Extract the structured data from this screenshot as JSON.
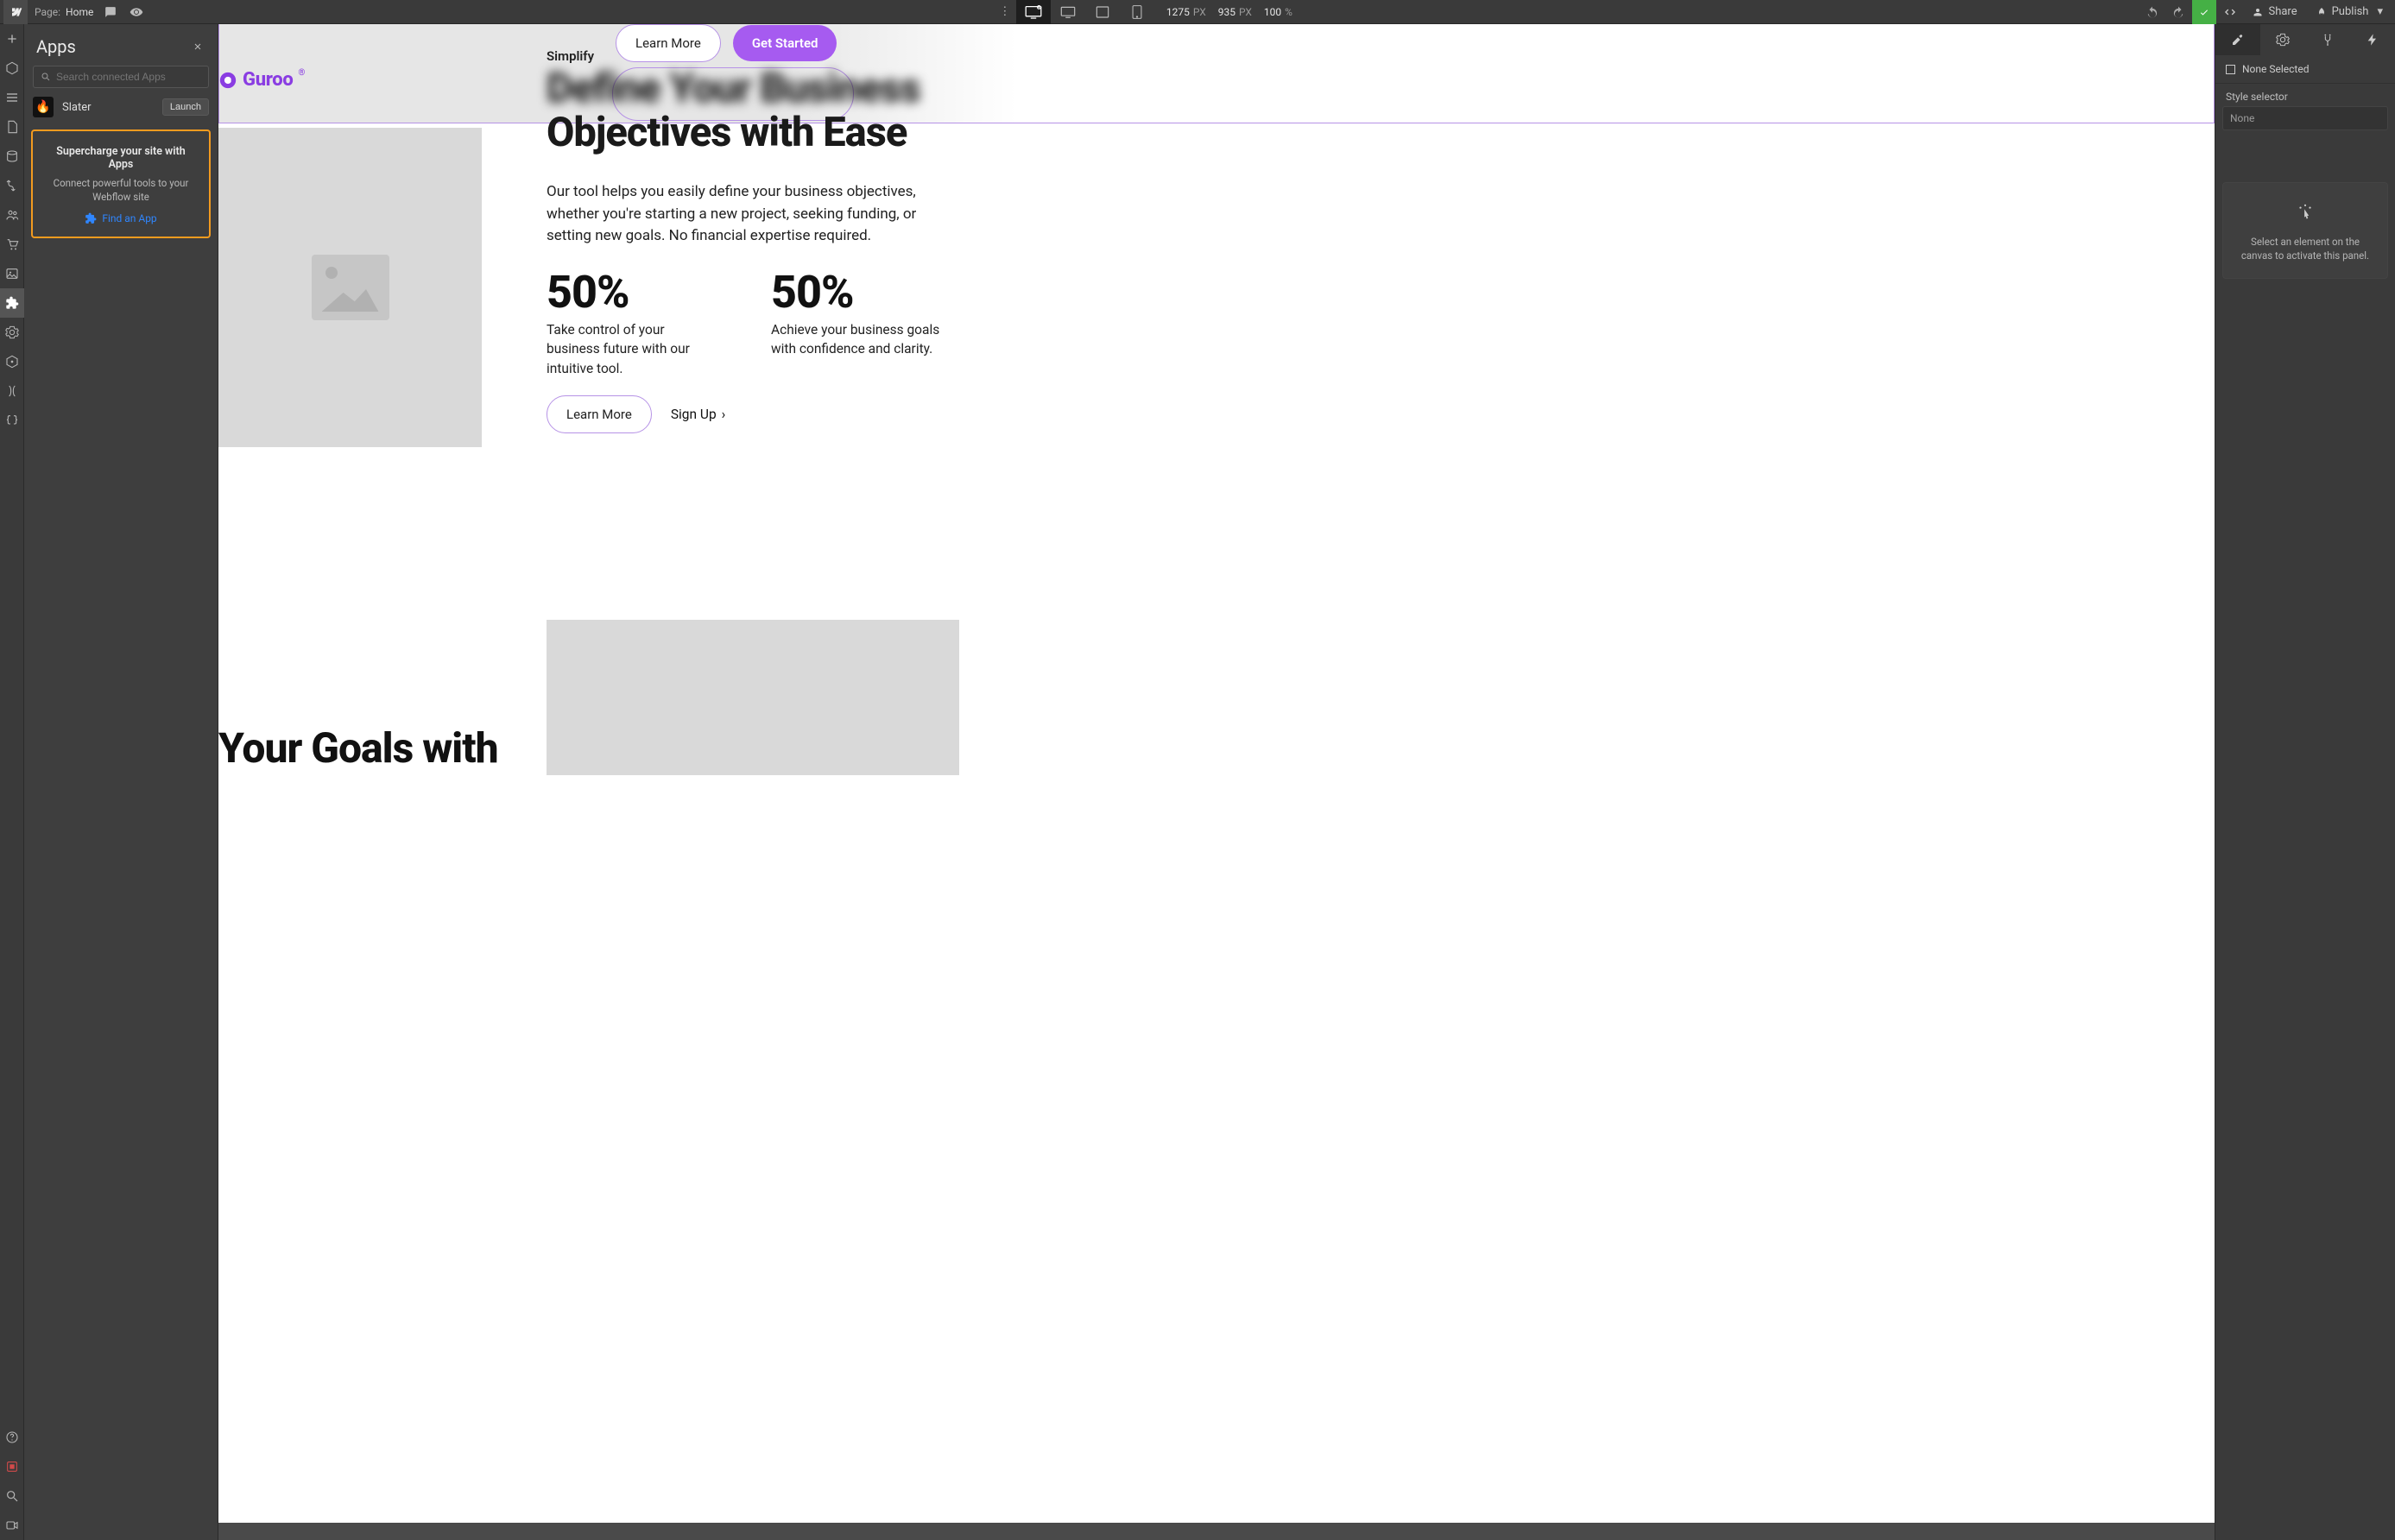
{
  "topbar": {
    "page_label": "Page:",
    "page_name": "Home",
    "width_val": "1275",
    "width_unit": "PX",
    "height_val": "935",
    "height_unit": "PX",
    "zoom_val": "100",
    "zoom_unit": "%",
    "share": "Share",
    "publish": "Publish"
  },
  "apps": {
    "title": "Apps",
    "search_placeholder": "Search connected Apps",
    "list": [
      {
        "name": "Slater",
        "launch": "Launch"
      }
    ],
    "promo": {
      "title": "Supercharge your site with Apps",
      "sub": "Connect powerful tools to your Webflow site",
      "link": "Find an App"
    }
  },
  "right": {
    "none_selected": "None Selected",
    "style_selector": "Style selector",
    "style_value": "None",
    "placeholder": "Select an element on the canvas to activate this panel."
  },
  "canvas": {
    "brand": "Guroo",
    "nav_learn": "Learn More",
    "nav_get_started": "Get Started",
    "small_label": "Simplify",
    "headline_blur": "Define Your Business",
    "headline_line2": "Objectives with Ease",
    "body": "Our tool helps you easily define your business objectives, whether you're starting a new project, seeking funding, or setting new goals. No financial expertise required.",
    "stat1_val": "50%",
    "stat1_cap": "Take control of your business future with our intuitive tool.",
    "stat2_val": "50%",
    "stat2_cap": "Achieve your business goals with confidence and clarity.",
    "cta_learn": "Learn More",
    "cta_signup": "Sign Up",
    "bottom_h2": "Your Goals with"
  }
}
